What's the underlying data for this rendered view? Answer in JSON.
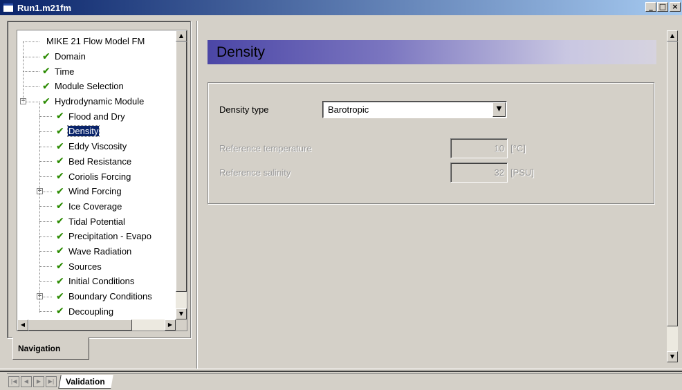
{
  "window": {
    "title": "Run1.m21fm",
    "buttons": {
      "minimize": "_",
      "maximize": "□",
      "close": "×"
    }
  },
  "navigation": {
    "tab_label": "Navigation",
    "tree": [
      {
        "label": "MIKE 21 Flow Model FM",
        "level": 0,
        "checked": false,
        "expander": ""
      },
      {
        "label": "Domain",
        "level": 1,
        "checked": true,
        "expander": ""
      },
      {
        "label": "Time",
        "level": 1,
        "checked": true,
        "expander": ""
      },
      {
        "label": "Module Selection",
        "level": 1,
        "checked": true,
        "expander": ""
      },
      {
        "label": "Hydrodynamic Module",
        "level": 1,
        "checked": true,
        "expander": "−"
      },
      {
        "label": "Flood and Dry",
        "level": 2,
        "checked": true,
        "expander": ""
      },
      {
        "label": "Density",
        "level": 2,
        "checked": true,
        "expander": "",
        "selected": true
      },
      {
        "label": "Eddy Viscosity",
        "level": 2,
        "checked": true,
        "expander": ""
      },
      {
        "label": "Bed Resistance",
        "level": 2,
        "checked": true,
        "expander": ""
      },
      {
        "label": "Coriolis Forcing",
        "level": 2,
        "checked": true,
        "expander": ""
      },
      {
        "label": "Wind Forcing",
        "level": 2,
        "checked": true,
        "expander": "+"
      },
      {
        "label": "Ice Coverage",
        "level": 2,
        "checked": true,
        "expander": ""
      },
      {
        "label": "Tidal Potential",
        "level": 2,
        "checked": true,
        "expander": ""
      },
      {
        "label": "Precipitation - Evapo",
        "level": 2,
        "checked": true,
        "expander": ""
      },
      {
        "label": "Wave Radiation",
        "level": 2,
        "checked": true,
        "expander": ""
      },
      {
        "label": "Sources",
        "level": 2,
        "checked": true,
        "expander": ""
      },
      {
        "label": "Initial Conditions",
        "level": 2,
        "checked": true,
        "expander": ""
      },
      {
        "label": "Boundary Conditions",
        "level": 2,
        "checked": true,
        "expander": "+"
      },
      {
        "label": "Decoupling",
        "level": 2,
        "checked": true,
        "expander": ""
      }
    ]
  },
  "content": {
    "header": "Density",
    "density_type_label": "Density type",
    "density_type_value": "Barotropic",
    "reference_temperature_label": "Reference temperature",
    "reference_temperature_value": "10",
    "reference_temperature_unit": "[°C]",
    "reference_salinity_label": "Reference salinity",
    "reference_salinity_value": "32",
    "reference_salinity_unit": "[PSU]"
  },
  "bottom": {
    "tab_label": "Validation"
  },
  "icons": {
    "check": "✔",
    "scroll_up": "▲",
    "scroll_down": "▼",
    "scroll_left": "◀",
    "scroll_right": "▶",
    "dropdown": "▼",
    "nav_first": "|◀",
    "nav_prev": "◀",
    "nav_next": "▶",
    "nav_last": "▶|"
  },
  "colors": {
    "titlebar_start": "#0a246a",
    "titlebar_end": "#a6caf0",
    "header_gradient_start": "#4b46a6",
    "check_green": "#2a8a00",
    "selection": "#0a246a"
  }
}
